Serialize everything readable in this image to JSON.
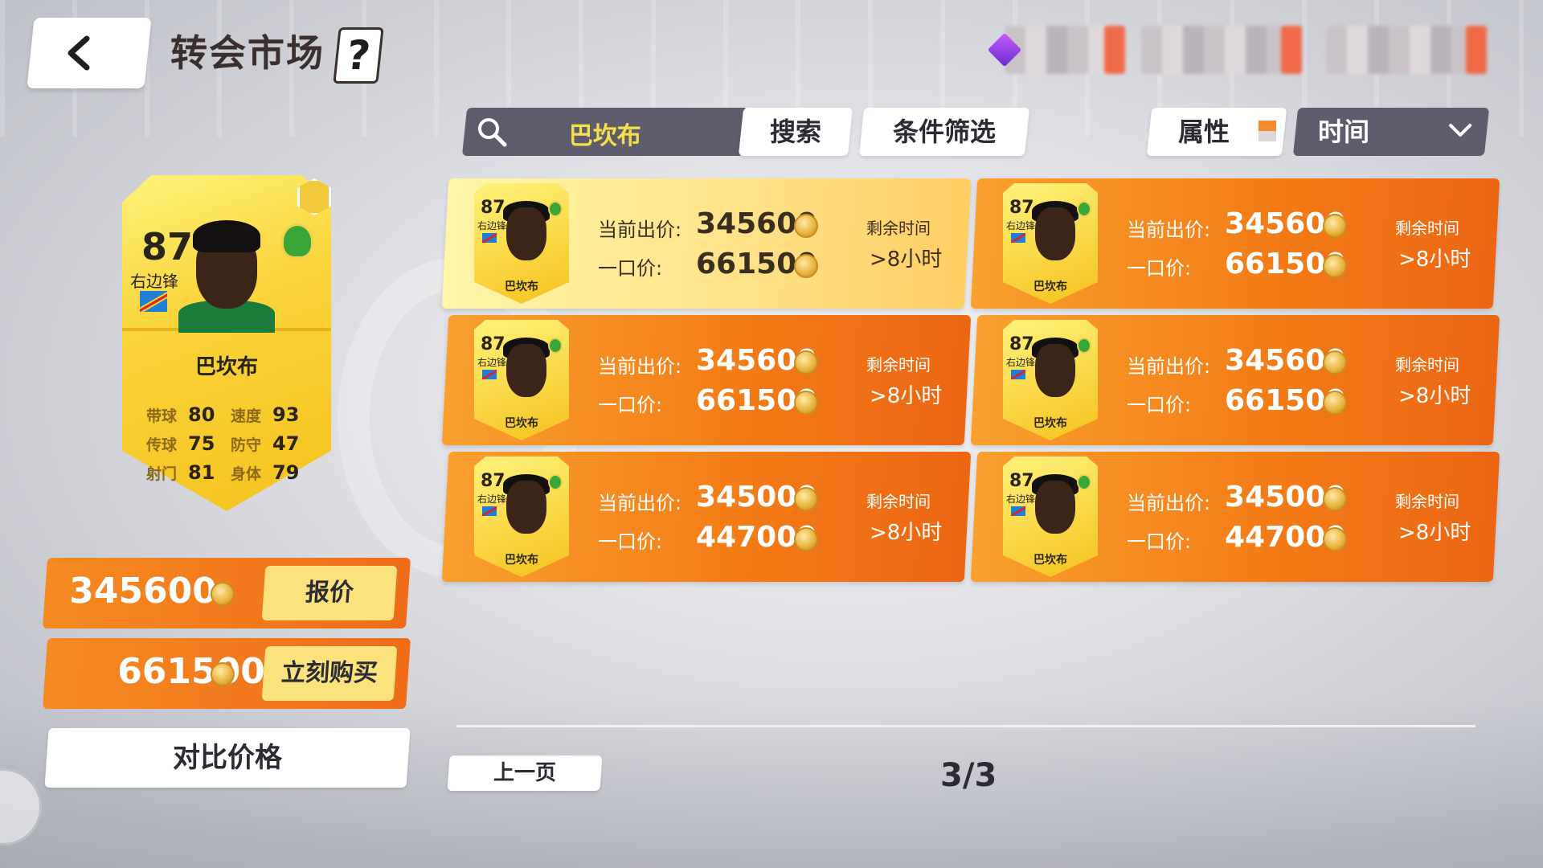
{
  "header": {
    "title": "转会市场",
    "help_label": "?"
  },
  "search": {
    "query": "巴坎布",
    "search_label": "搜索",
    "filter_label": "条件筛选",
    "attr_label": "属性",
    "sort_label": "时间"
  },
  "player": {
    "rating": "87",
    "position": "右边锋",
    "name": "巴坎布",
    "stats": [
      {
        "label": "带球",
        "value": "80"
      },
      {
        "label": "速度",
        "value": "93"
      },
      {
        "label": "传球",
        "value": "75"
      },
      {
        "label": "防守",
        "value": "47"
      },
      {
        "label": "射门",
        "value": "81"
      },
      {
        "label": "身体",
        "value": "79"
      }
    ]
  },
  "actions": {
    "bid_price": "345600",
    "bid_label": "报价",
    "buy_price": "661500",
    "buy_label": "立刻购买",
    "compare_label": "对比价格"
  },
  "listings": [
    {
      "bid_label": "当前出价:",
      "bid": "345600",
      "buyout_label": "一口价:",
      "buyout": "661500",
      "time_label": "剩余时间",
      "time": ">8小时",
      "selected": true
    },
    {
      "bid_label": "当前出价:",
      "bid": "345600",
      "buyout_label": "一口价:",
      "buyout": "661500",
      "time_label": "剩余时间",
      "time": ">8小时",
      "selected": false
    },
    {
      "bid_label": "当前出价:",
      "bid": "345600",
      "buyout_label": "一口价:",
      "buyout": "661500",
      "time_label": "剩余时间",
      "time": ">8小时",
      "selected": false
    },
    {
      "bid_label": "当前出价:",
      "bid": "345600",
      "buyout_label": "一口价:",
      "buyout": "661500",
      "time_label": "剩余时间",
      "time": ">8小时",
      "selected": false
    },
    {
      "bid_label": "当前出价:",
      "bid": "345000",
      "buyout_label": "一口价:",
      "buyout": "447000",
      "time_label": "剩余时间",
      "time": ">8小时",
      "selected": false
    },
    {
      "bid_label": "当前出价:",
      "bid": "345000",
      "buyout_label": "一口价:",
      "buyout": "447000",
      "time_label": "剩余时间",
      "time": ">8小时",
      "selected": false
    }
  ],
  "pagination": {
    "prev_label": "上一页",
    "page": "3/3"
  },
  "icons": {
    "back": "chevron-left-icon",
    "search": "search-icon",
    "sort": "chevron-down-icon",
    "coin": "coin-icon",
    "gem": "gem-icon"
  },
  "colors": {
    "accent_orange": "#f37d17",
    "selected_yellow": "#ffe38a",
    "search_query": "#f6e04a",
    "dark_panel": "#5f5d6d"
  }
}
